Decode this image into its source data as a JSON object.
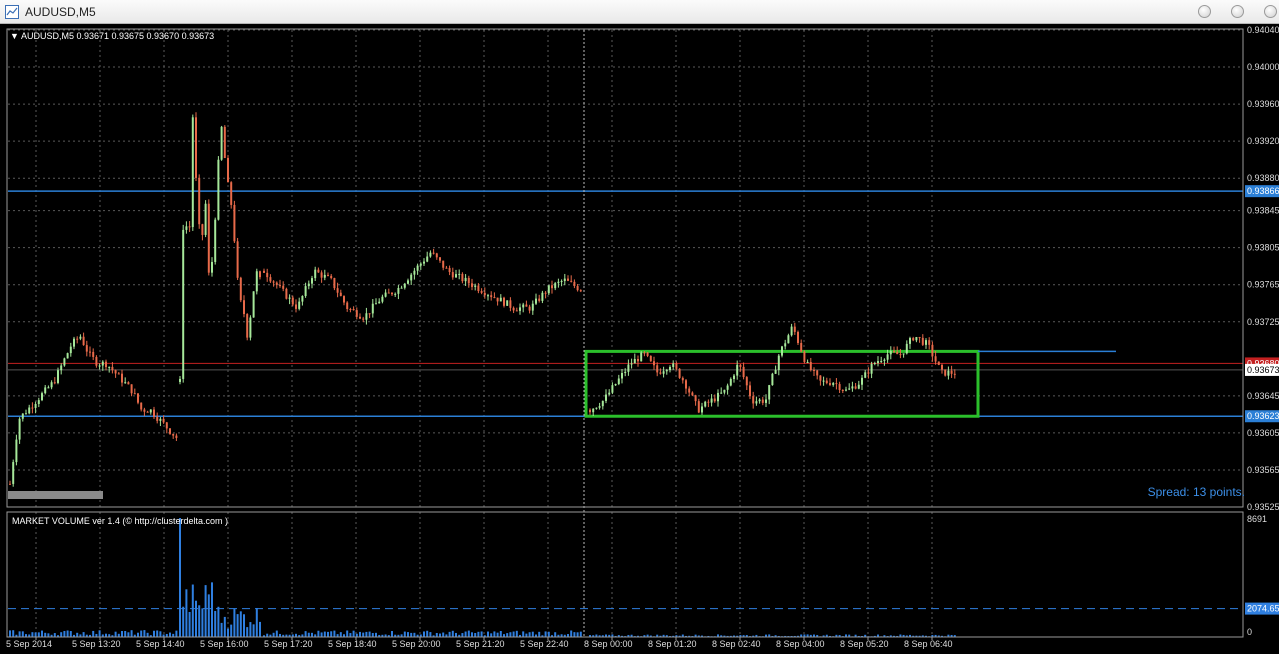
{
  "window": {
    "title": "AUDUSD,M5"
  },
  "chart_header": {
    "symbol": "AUDUSD,M5",
    "ohlc": "0.93671 0.93675 0.93670 0.93673"
  },
  "indicator": {
    "name": "MARKET VOLUME ver 1.4 (© http://clusterdelta.com )"
  },
  "spread_text": "Spread: 13 points.",
  "colors": {
    "background": "#000000",
    "grid": "#5a5a5a",
    "candle_up": "#a6e89a",
    "candle_down": "#e86a4a",
    "hline_blue": "#2b7fd6",
    "bid_line": "#c42020",
    "range_box": "#2bbf2b",
    "volume": "#2f7fe0"
  },
  "chart_data": {
    "type": "candlestick",
    "symbol": "AUDUSD",
    "timeframe": "M5",
    "price_axis_labels": [
      "0.94040",
      "0.94000",
      "0.93960",
      "0.93920",
      "0.93880",
      "0.93845",
      "0.93805",
      "0.93765",
      "0.93725",
      "0.93645",
      "0.93605",
      "0.93565",
      "0.93525"
    ],
    "price_range": [
      0.93525,
      0.9404
    ],
    "time_axis_labels": [
      "5 Sep 2014",
      "5 Sep 13:20",
      "5 Sep 14:40",
      "5 Sep 16:00",
      "5 Sep 17:20",
      "5 Sep 18:40",
      "5 Sep 20:00",
      "5 Sep 21:20",
      "5 Sep 22:40",
      "8 Sep 00:00",
      "8 Sep 01:20",
      "8 Sep 02:40",
      "8 Sep 04:00",
      "8 Sep 05:20",
      "8 Sep 06:40"
    ],
    "horizontal_lines": [
      {
        "name": "upper-resistance",
        "price": 0.93866,
        "label": "0.93866",
        "color": "#2b7fd6"
      },
      {
        "name": "lower-support",
        "price": 0.93623,
        "label": "0.93623",
        "color": "#2b7fd6"
      },
      {
        "name": "bid-line",
        "price": 0.9368,
        "label": "0.93680",
        "color": "#c42020"
      },
      {
        "name": "current-price",
        "price": 0.93673,
        "label": "0.93673",
        "color": "#ffffff"
      }
    ],
    "range_box": {
      "from_time": "8 Sep 00:00",
      "price_high": 0.93693,
      "price_low": 0.93623
    },
    "volume_axis": {
      "max_label": "8691",
      "avg_label": "2074.65",
      "min_label": "0"
    },
    "volume_avg": 2074.65,
    "volume_max": 8691,
    "segments": [
      {
        "from": "5 Sep 2014",
        "prices": [
          0.9355,
          0.9362,
          0.9363,
          0.9364,
          0.9365,
          0.9366,
          0.9368,
          0.937,
          0.9371,
          0.9369,
          0.9368,
          0.9368,
          0.9367,
          0.9366,
          0.9365,
          0.9363,
          0.9363,
          0.9362,
          0.9361,
          0.936
        ],
        "volume": 320
      },
      {
        "from": "5 Sep 14:40",
        "prices": [
          0.9366,
          0.9388,
          0.9378,
          0.9395,
          0.9386,
          0.938,
          0.9386,
          0.9376,
          0.9381,
          0.9389,
          0.9394,
          0.9388,
          0.9386,
          0.9381,
          0.9375,
          0.9374,
          0.9371,
          0.9374,
          0.9378,
          0.9377
        ],
        "volume": 1500
      },
      {
        "from": "5 Sep 18:40",
        "prices": [
          0.9378,
          0.9376,
          0.9374,
          0.9378,
          0.9377,
          0.9374,
          0.9373,
          0.9375,
          0.9376,
          0.9378,
          0.938,
          0.9378,
          0.9377,
          0.9376,
          0.9375,
          0.9374,
          0.9374,
          0.9376,
          0.9377,
          0.9376
        ],
        "volume": 300
      },
      {
        "from": "8 Sep 00:00",
        "prices": [
          0.9363,
          0.9364,
          0.9366,
          0.9368,
          0.9369,
          0.9367,
          0.9368,
          0.9366,
          0.9363,
          0.9364,
          0.9365,
          0.9368,
          0.9364,
          0.9364,
          0.9369,
          0.9372,
          0.9368,
          0.9366,
          0.9366,
          0.9365,
          0.9366,
          0.9368,
          0.9369,
          0.9369,
          0.9371,
          0.937,
          0.9367,
          0.9367
        ],
        "volume": 120
      }
    ]
  }
}
